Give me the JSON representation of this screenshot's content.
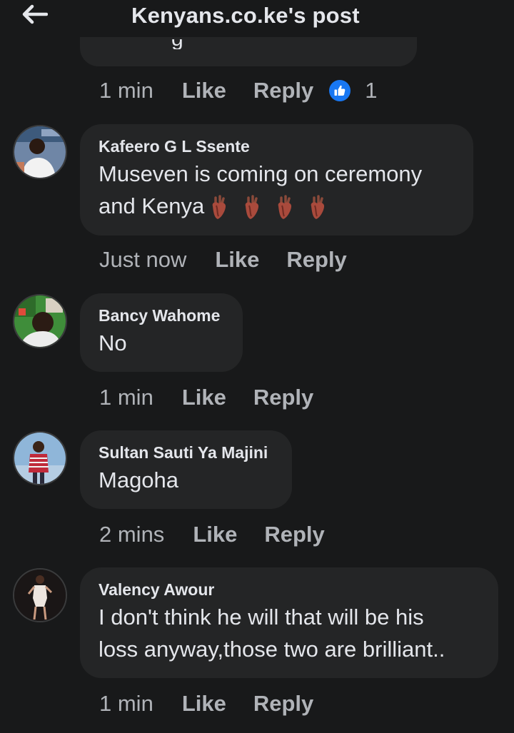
{
  "header": {
    "title": "Kenyans.co.ke's post",
    "back_icon": "arrow-left-icon"
  },
  "previous_comment": {
    "time": "1 min",
    "like_label": "Like",
    "reply_label": "Reply",
    "reaction_icon": "thumbs-up-icon",
    "reaction_count": "1"
  },
  "comments": [
    {
      "author": "Kafeero G L Ssente",
      "text": "Museven is coming on ceremony",
      "text_line2": "and Kenya",
      "emoji": [
        "anatomical-heart-icon",
        "anatomical-heart-icon",
        "anatomical-heart-icon",
        "anatomical-heart-icon"
      ],
      "time": "Just now",
      "like_label": "Like",
      "reply_label": "Reply"
    },
    {
      "author": "Bancy Wahome",
      "text": "No",
      "time": "1 min",
      "like_label": "Like",
      "reply_label": "Reply"
    },
    {
      "author": "Sultan Sauti Ya Majini",
      "text": "Magoha",
      "time": "2 mins",
      "like_label": "Like",
      "reply_label": "Reply"
    },
    {
      "author": "Valency Awour",
      "text": "I don't think he will that will be his",
      "text_line2": "loss anyway,those two are brilliant..",
      "time": "1 min",
      "like_label": "Like",
      "reply_label": "Reply"
    }
  ],
  "colors": {
    "background": "#18191a",
    "bubble": "#242526",
    "primary_text": "#e4e6eb",
    "secondary_text": "#b0b3b8",
    "reaction_blue": "#1877f2"
  }
}
